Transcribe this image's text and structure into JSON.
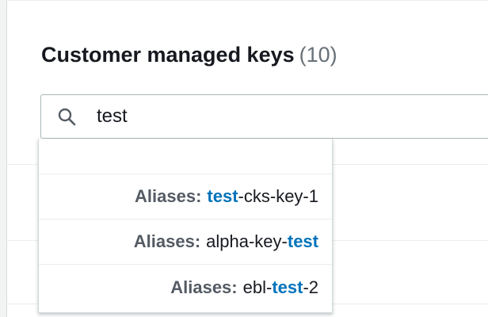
{
  "page": {
    "title": "Customer managed keys",
    "count": "(10)"
  },
  "search": {
    "value": "test",
    "icon": "search-icon"
  },
  "suggestions": [
    {
      "label": "Aliases:",
      "before": "",
      "match": "test",
      "after": "-cks-key-1"
    },
    {
      "label": "Aliases:",
      "before": "alpha-key-",
      "match": "test",
      "after": ""
    },
    {
      "label": "Aliases:",
      "before": "ebl-",
      "match": "test",
      "after": "-2"
    }
  ],
  "colors": {
    "highlight": "#0073bb",
    "text": "#16191f",
    "muted": "#687078"
  }
}
